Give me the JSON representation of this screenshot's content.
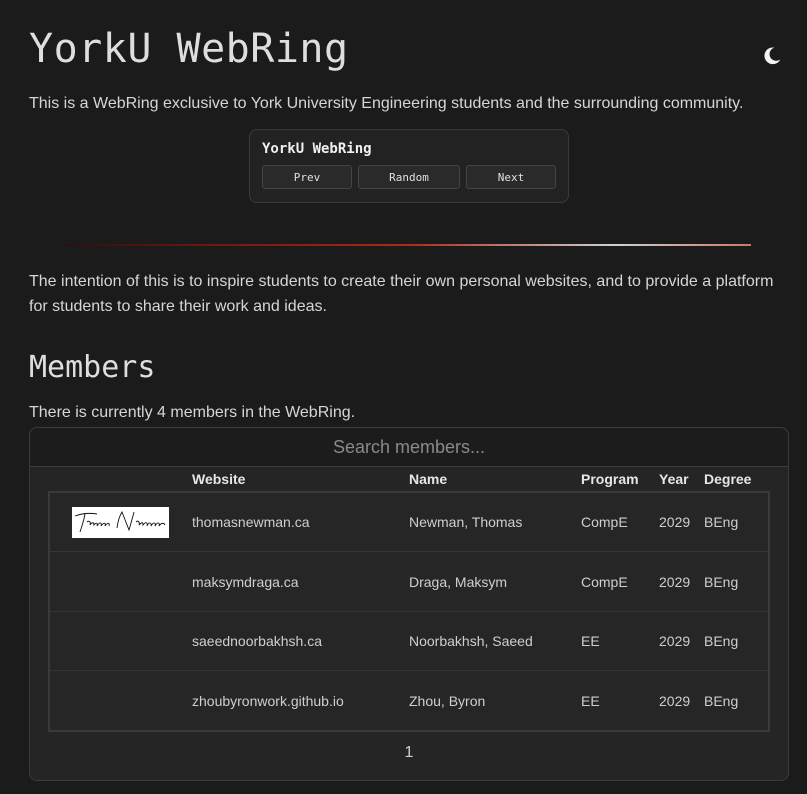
{
  "site": {
    "title": "YorkU WebRing",
    "intro": "This is a WebRing exclusive to York University Engineering students and the surrounding community."
  },
  "icons": {
    "theme_toggle": "moon-icon"
  },
  "webring_widget": {
    "title": "YorkU WebRing",
    "prev_label": "Prev",
    "random_label": "Random",
    "next_label": "Next"
  },
  "intention": "The intention of this is to inspire students to create their own personal websites, and to provide a platform for students to share their work and ideas.",
  "members": {
    "heading": "Members",
    "count_text": "There is currently 4 members in the WebRing.",
    "search_placeholder": "Search members...",
    "columns": [
      "Website",
      "Name",
      "Program",
      "Year",
      "Degree"
    ],
    "rows": [
      {
        "website": "thomasnewman.ca",
        "name": "Newman, Thomas",
        "program": "CompE",
        "year": "2029",
        "degree": "BEng",
        "logo": "Thomas Newman"
      },
      {
        "website": "maksymdraga.ca",
        "name": "Draga, Maksym",
        "program": "CompE",
        "year": "2029",
        "degree": "BEng"
      },
      {
        "website": "saeednoorbakhsh.ca",
        "name": "Noorbakhsh, Saeed",
        "program": "EE",
        "year": "2029",
        "degree": "BEng"
      },
      {
        "website": "zhoubyronwork.github.io",
        "name": "Zhou, Byron",
        "program": "EE",
        "year": "2029",
        "degree": "BEng"
      }
    ],
    "page": "1"
  },
  "colors": {
    "background": "#1b1b1c",
    "panel": "#252526",
    "text": "#d2d2d2",
    "accent_red": "#b2281a"
  }
}
